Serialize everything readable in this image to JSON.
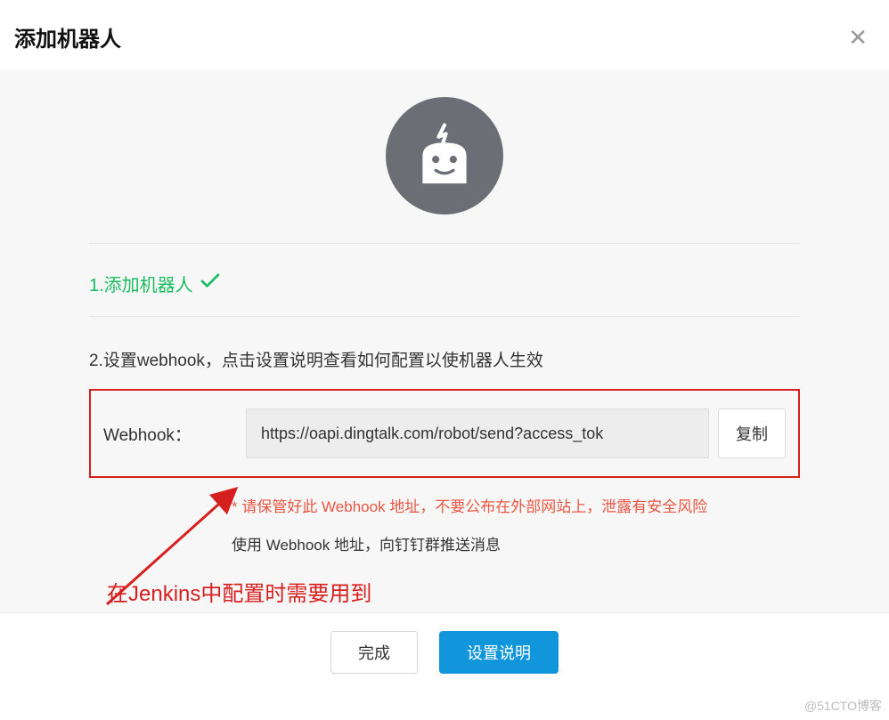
{
  "modal": {
    "title": "添加机器人"
  },
  "steps": {
    "step1_label": "1.添加机器人",
    "step2_label": "2.设置webhook，点击设置说明查看如何配置以使机器人生效"
  },
  "webhook": {
    "label": "Webhook：",
    "value": "https://oapi.dingtalk.com/robot/send?access_tok",
    "copy_label": "复制",
    "warning": "* 请保管好此 Webhook 地址，不要公布在外部网站上，泄露有安全风险",
    "info": "使用 Webhook 地址，向钉钉群推送消息"
  },
  "annotation": {
    "text": "在Jenkins中配置时需要用到"
  },
  "footer": {
    "done_label": "完成",
    "settings_label": "设置说明"
  },
  "watermark": "@51CTO博客"
}
